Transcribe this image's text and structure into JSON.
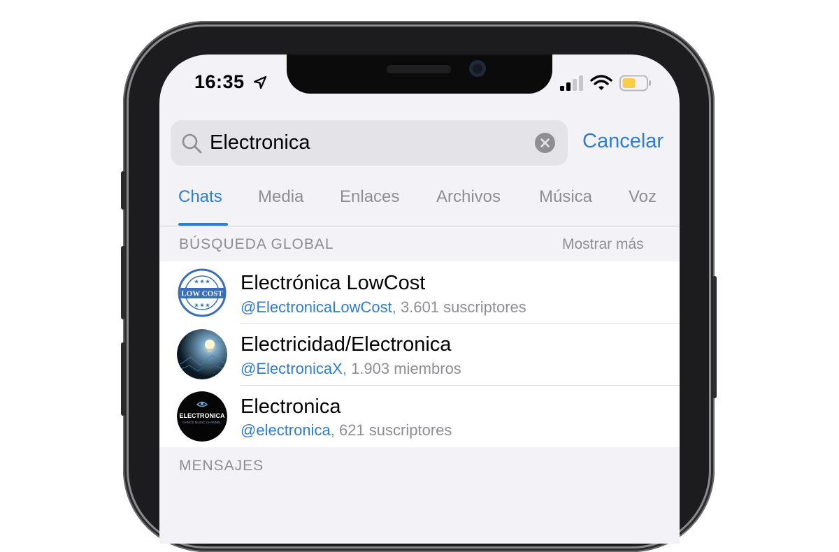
{
  "status": {
    "time": "16:35"
  },
  "search": {
    "query": "Electronica",
    "cancel_label": "Cancelar"
  },
  "tabs": [
    {
      "label": "Chats",
      "active": true
    },
    {
      "label": "Media"
    },
    {
      "label": "Enlaces"
    },
    {
      "label": "Archivos"
    },
    {
      "label": "Música"
    },
    {
      "label": "Voz"
    }
  ],
  "global_search": {
    "title": "BÚSQUEDA GLOBAL",
    "show_more": "Mostrar más",
    "results": [
      {
        "name": "Electrónica LowCost",
        "handle": "@ElectronicaLowCost",
        "meta": ", 3.601 suscriptores",
        "avatar_text": "LOW COST"
      },
      {
        "name": "Electricidad/Electronica",
        "handle": "@ElectronicaX",
        "meta": ", 1.903 miembros"
      },
      {
        "name": "Electronica",
        "handle": "@electronica",
        "meta": ", 621 suscriptores",
        "avatar_text": "ELECTRONICA",
        "avatar_subtext": "DANCE MUSIC CHANNEL"
      }
    ]
  },
  "messages_section": {
    "title": "MENSAJES"
  },
  "colors": {
    "accent": "#2f7dd3",
    "secondary_text": "#8e8e93",
    "background": "#f2f2f7"
  },
  "icons": [
    "location-arrow-icon",
    "signal-icon",
    "wifi-icon",
    "battery-icon",
    "search-icon",
    "clear-icon"
  ]
}
